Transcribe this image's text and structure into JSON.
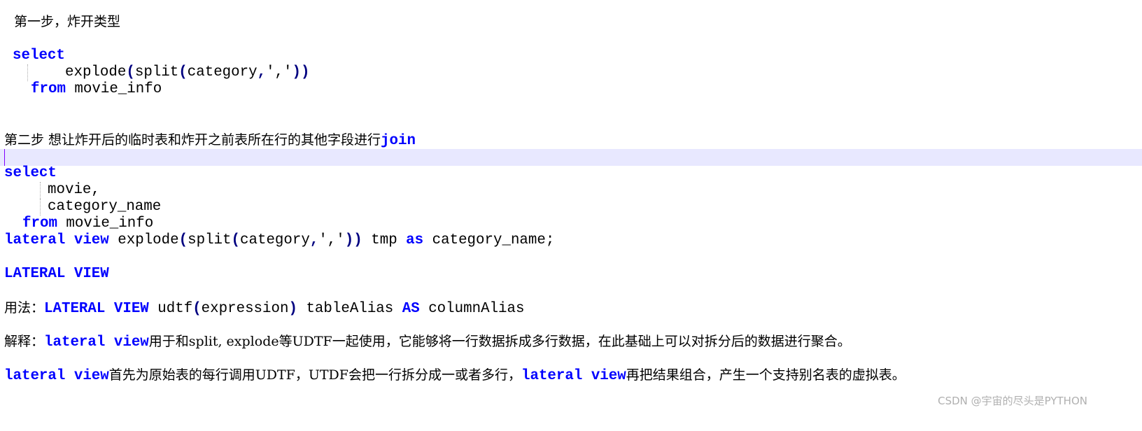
{
  "editor": {
    "step1_heading": "第一步，炸开类型",
    "q1": {
      "select": "select",
      "explode": "explode",
      "split": "split",
      "category": "category",
      "comma": "','",
      "from": "from",
      "table": "movie_info"
    },
    "step2_heading": "第二步 想让炸开后的临时表和炸开之前表所在行的其他字段进行",
    "step2_join": "join",
    "q2": {
      "select": "select",
      "movie": "movie,",
      "category_name": "category_name",
      "from": "from",
      "table": "movie_info",
      "lateral_view": "lateral view",
      "explode": "explode",
      "split": "split",
      "category": "category",
      "comma": "','",
      "tmp": "tmp",
      "as": "as",
      "alias": "category_name;"
    },
    "lateral_heading": "LATERAL VIEW",
    "usage": {
      "label": "用法：",
      "kw1": "LATERAL VIEW",
      "udtf": "udtf",
      "expr": "expression",
      "alias": "tableAlias",
      "as": "AS",
      "col": "columnAlias"
    },
    "explain": {
      "label": "解释：",
      "kw": "lateral view",
      "text": "用于和split, explode等UDTF一起使用，它能够将一行数据拆成多行数据，在此基础上可以对拆分后的数据进行聚合。"
    },
    "explain2": {
      "kw1": "lateral view",
      "text1": "首先为原始表的每行调用UDTF，UTDF会把一行拆分成一或者多行，",
      "kw2": "lateral view",
      "text2": "再把结果组合，产生一个支持别名表的虚拟表。"
    }
  },
  "watermark": "CSDN @宇宙的尽头是PYTHON",
  "colors": {
    "keyword": "#0000ff",
    "operator": "#000080",
    "current_line": "#e8e8ff"
  }
}
